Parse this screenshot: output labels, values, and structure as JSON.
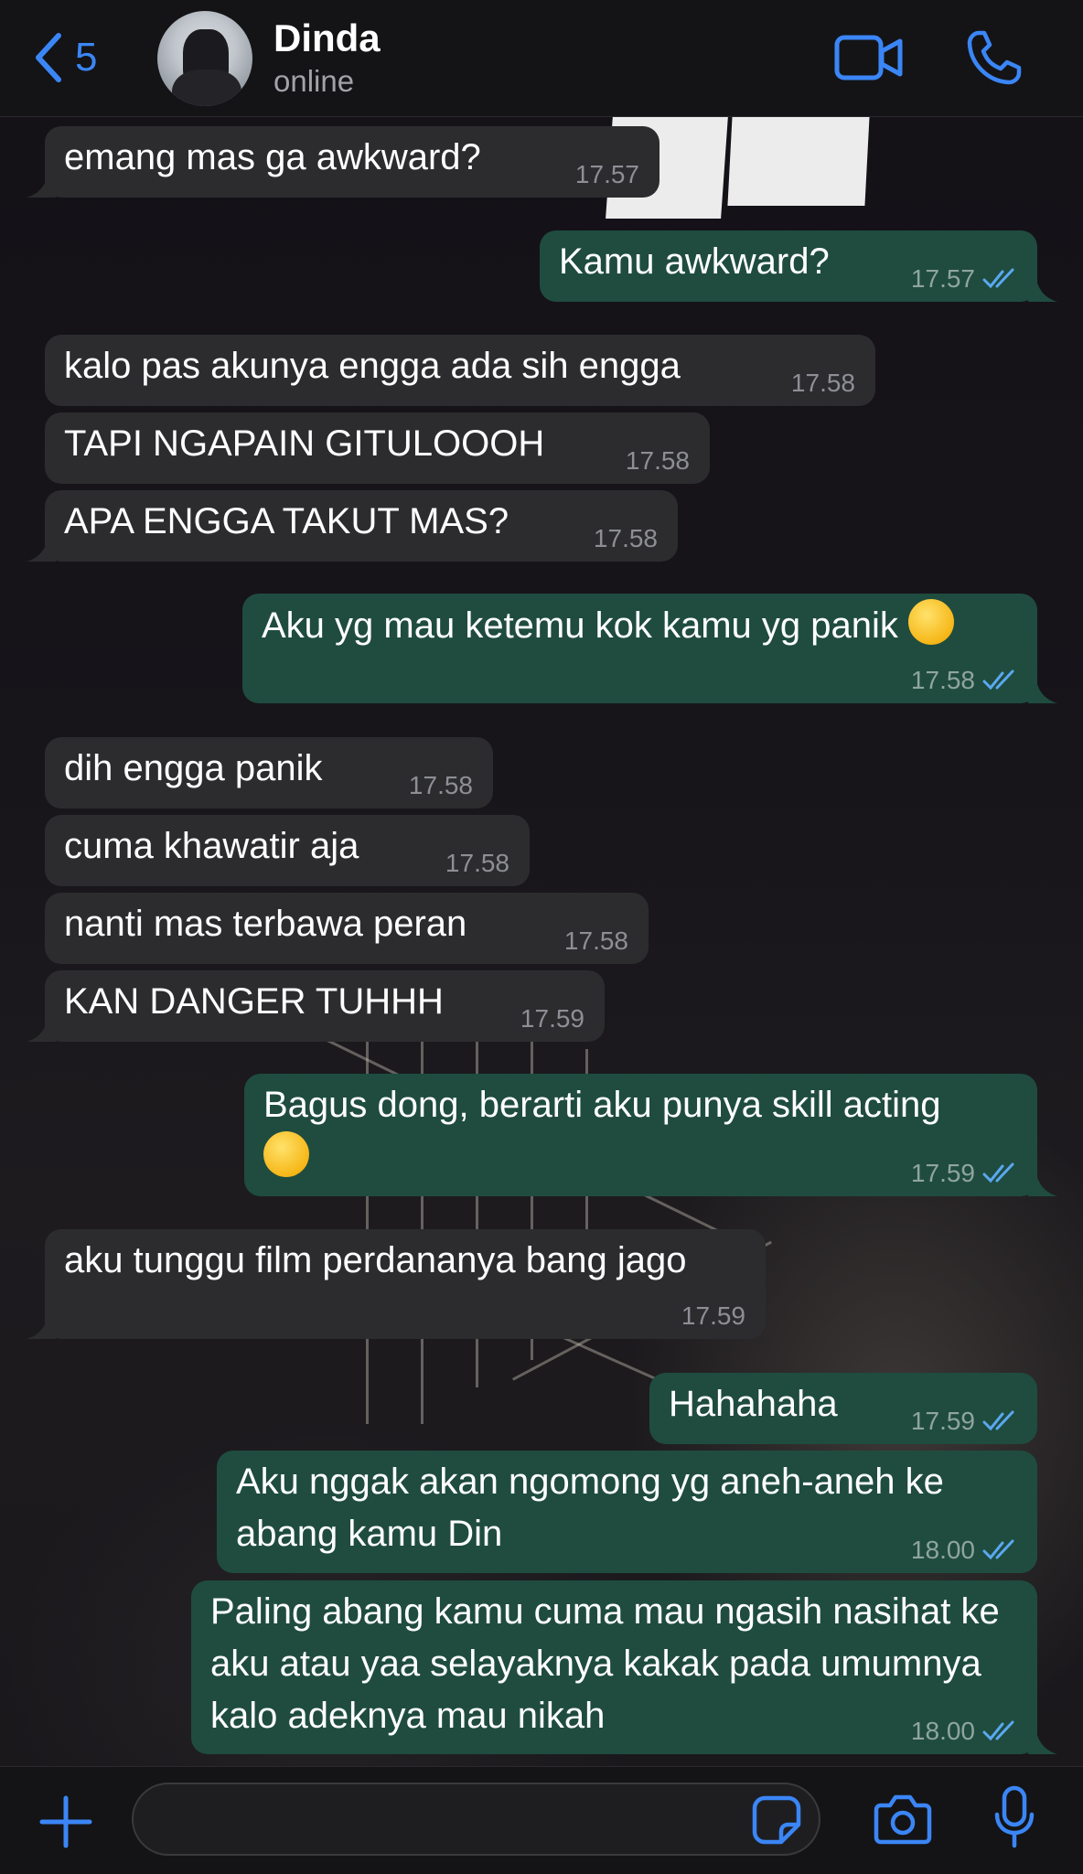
{
  "header": {
    "back_count": "5",
    "contact_name": "Dinda",
    "contact_status": "online"
  },
  "messages": [
    {
      "dir": "in",
      "text": "emang mas ga awkward?",
      "time": "17.57"
    },
    {
      "dir": "out",
      "text": "Kamu awkward?",
      "time": "17.57"
    },
    {
      "dir": "in",
      "text": "kalo pas akunya engga ada sih engga",
      "time": "17.58"
    },
    {
      "dir": "in",
      "text": "TAPI NGAPAIN GITULOOOH",
      "time": "17.58"
    },
    {
      "dir": "in",
      "text": "APA ENGGA TAKUT MAS?",
      "time": "17.58"
    },
    {
      "dir": "out",
      "text": "Aku yg mau ketemu kok kamu yg panik",
      "emoji": "face-with-tears-of-joy",
      "time": "17.58"
    },
    {
      "dir": "in",
      "text": "dih engga panik",
      "time": "17.58"
    },
    {
      "dir": "in",
      "text": "cuma khawatir aja",
      "time": "17.58"
    },
    {
      "dir": "in",
      "text": "nanti mas terbawa peran",
      "time": "17.58"
    },
    {
      "dir": "in",
      "text": "KAN DANGER TUHHH",
      "time": "17.59"
    },
    {
      "dir": "out",
      "text": "Bagus dong, berarti aku punya skill acting",
      "emoji": "smiling-face-with-sunglasses",
      "time": "17.59"
    },
    {
      "dir": "in",
      "text": "aku tunggu film perdananya bang jago",
      "time": "17.59"
    },
    {
      "dir": "out",
      "text": "Hahahaha",
      "time": "17.59"
    },
    {
      "dir": "out",
      "text": "Aku nggak akan ngomong yg aneh-aneh ke abang kamu Din",
      "time": "18.00"
    },
    {
      "dir": "out",
      "text": "Paling abang kamu cuma mau ngasih nasihat ke aku atau yaa selayaknya kakak pada umumnya kalo adeknya mau nikah",
      "time": "18.00"
    }
  ],
  "input": {
    "value": "",
    "placeholder": ""
  },
  "colors": {
    "accent": "#3b86f6",
    "incoming_bubble": "#2c2c2f",
    "outgoing_bubble": "#1f4c3f",
    "read_ticks": "#5aa8f0"
  },
  "icons": {
    "back": "chevron-left-icon",
    "video": "video-camera-icon",
    "call": "phone-icon",
    "attach": "plus-icon",
    "sticker": "sticker-icon",
    "camera": "camera-icon",
    "mic": "microphone-icon"
  }
}
